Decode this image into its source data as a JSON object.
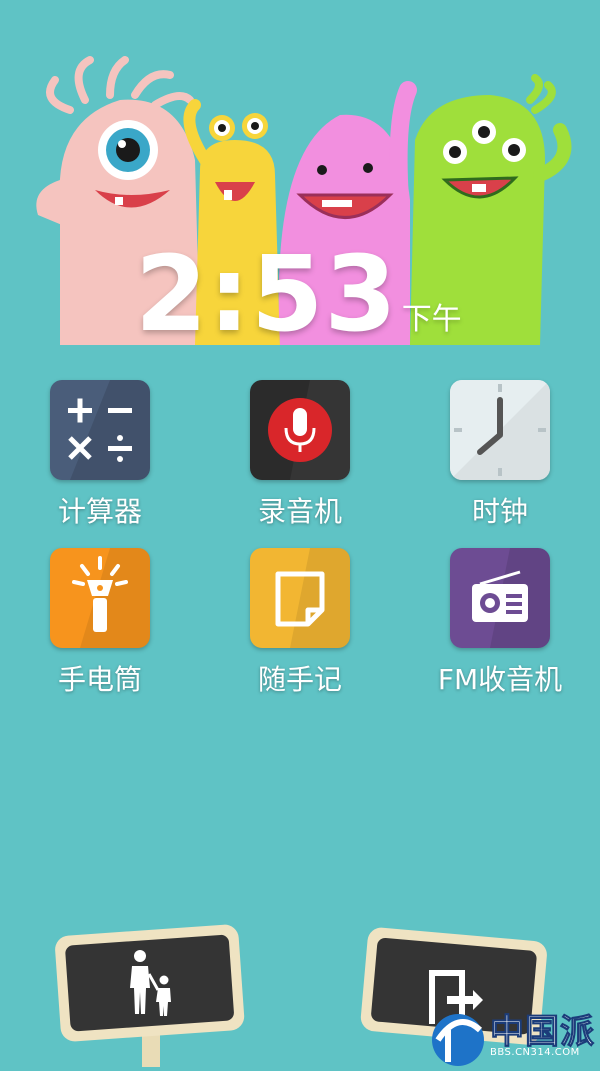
{
  "clock": {
    "time": "2:53",
    "ampm": "下午"
  },
  "apps": [
    {
      "label": "计算器",
      "icon": "calculator-icon"
    },
    {
      "label": "录音机",
      "icon": "microphone-icon"
    },
    {
      "label": "时钟",
      "icon": "clock-icon"
    },
    {
      "label": "手电筒",
      "icon": "flashlight-icon"
    },
    {
      "label": "随手记",
      "icon": "note-icon"
    },
    {
      "label": "FM收音机",
      "icon": "radio-icon"
    }
  ],
  "bottom": {
    "left_icon": "parent-child-icon",
    "right_icon": "exit-door-icon"
  },
  "watermark": {
    "text": "中国派",
    "url": "BBS.CN314.COM"
  },
  "colors": {
    "background": "#5fc3c5",
    "calculator": "#4a5d7a",
    "recorder": "#2b2b2b",
    "recorder_accent": "#d9262a",
    "clock": "#dbe7ea",
    "flashlight": "#f7941d",
    "note": "#f2b632",
    "radio": "#6d4c93"
  }
}
